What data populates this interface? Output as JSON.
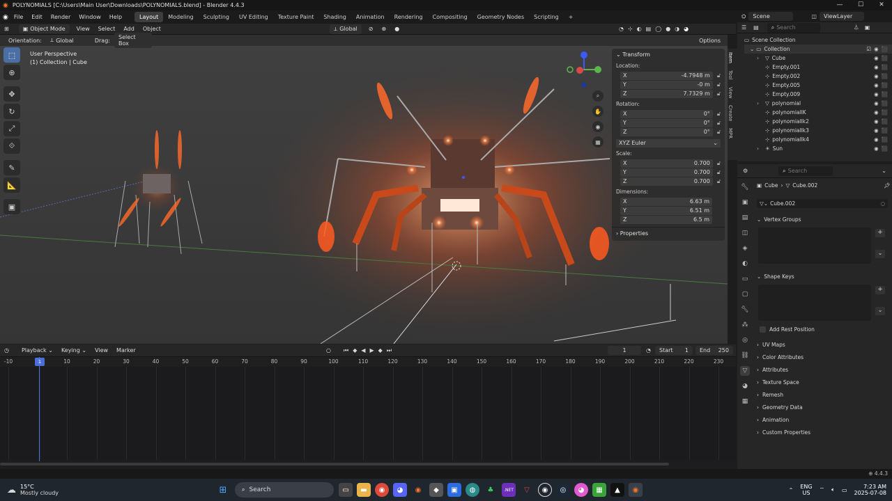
{
  "titlebar": {
    "title": "POLYNOMIALS [C:\\Users\\Main User\\Downloads\\POLYNOMIALS.blend] - Blender 4.4.3"
  },
  "menu": [
    "File",
    "Edit",
    "Render",
    "Window",
    "Help"
  ],
  "workspaces": [
    "Layout",
    "Modeling",
    "Sculpting",
    "UV Editing",
    "Texture Paint",
    "Shading",
    "Animation",
    "Rendering",
    "Compositing",
    "Geometry Nodes",
    "Scripting"
  ],
  "scene": {
    "name": "Scene",
    "view_layer": "ViewLayer"
  },
  "viewport_header": {
    "mode": "Object Mode",
    "view": "View",
    "select": "Select",
    "add": "Add",
    "object": "Object",
    "transform_orientation": "Global"
  },
  "tool_header": {
    "orientation_label": "Orientation:",
    "orientation_value": "Global",
    "drag_label": "Drag:",
    "drag_value": "Select Box",
    "options": "Options"
  },
  "viewport_info": {
    "line1": "User Perspective",
    "line2": "(1) Collection | Cube"
  },
  "npanel": {
    "tabs": [
      "Item",
      "Tool",
      "View",
      "Create",
      "MPR"
    ],
    "transform_title": "Transform",
    "location_label": "Location:",
    "location": [
      {
        "axis": "X",
        "value": "-4.7948 m"
      },
      {
        "axis": "Y",
        "value": "-0 m"
      },
      {
        "axis": "Z",
        "value": "7.7329 m"
      }
    ],
    "rotation_label": "Rotation:",
    "rotation": [
      {
        "axis": "X",
        "value": "0°"
      },
      {
        "axis": "Y",
        "value": "0°"
      },
      {
        "axis": "Z",
        "value": "0°"
      }
    ],
    "rotation_mode": "XYZ Euler",
    "scale_label": "Scale:",
    "scale": [
      {
        "axis": "X",
        "value": "0.700"
      },
      {
        "axis": "Y",
        "value": "0.700"
      },
      {
        "axis": "Z",
        "value": "0.700"
      }
    ],
    "dimensions_label": "Dimensions:",
    "dimensions": [
      {
        "axis": "X",
        "value": "6.63 m"
      },
      {
        "axis": "Y",
        "value": "6.51 m"
      },
      {
        "axis": "Z",
        "value": "6.5 m"
      }
    ],
    "properties_title": "Properties"
  },
  "timeline": {
    "playback": "Playback",
    "keying": "Keying",
    "view": "View",
    "marker": "Marker",
    "current_frame": "1",
    "start_label": "Start",
    "start": "1",
    "end_label": "End",
    "end": "250",
    "ticks": [
      "-10",
      "1",
      "10",
      "20",
      "30",
      "40",
      "50",
      "60",
      "70",
      "80",
      "90",
      "100",
      "110",
      "120",
      "130",
      "140",
      "150",
      "160",
      "170",
      "180",
      "190",
      "200",
      "210",
      "220",
      "230"
    ]
  },
  "outliner": {
    "search_placeholder": "Search",
    "root": "Scene Collection",
    "collection": "Collection",
    "items": [
      "Cube",
      "Empty.001",
      "Empty.002",
      "Empty.005",
      "Empty.009",
      "polynomial",
      "polynomialIK",
      "polynomialIk2",
      "polynomialIk3",
      "polynomialIk4",
      "Sun"
    ]
  },
  "properties": {
    "search_placeholder": "Search",
    "breadcrumb_object": "Cube",
    "breadcrumb_data": "Cube.002",
    "mesh_name": "Cube.002",
    "vertex_groups": "Vertex Groups",
    "shape_keys": "Shape Keys",
    "add_rest_position": "Add Rest Position",
    "sections": [
      "UV Maps",
      "Color Attributes",
      "Attributes",
      "Texture Space",
      "Remesh",
      "Geometry Data",
      "Animation",
      "Custom Properties"
    ]
  },
  "statusbar": {
    "version": "4.4.3"
  },
  "taskbar": {
    "weather_temp": "15°C",
    "weather_desc": "Mostly cloudy",
    "search": "Search",
    "lang1": "ENG",
    "lang2": "US",
    "time": "7:23 AM",
    "date": "2025-07-08"
  },
  "colors": {
    "accent": "#4a6fa5",
    "glow": "#ff6a2a",
    "selection": "#ff8c3a"
  }
}
